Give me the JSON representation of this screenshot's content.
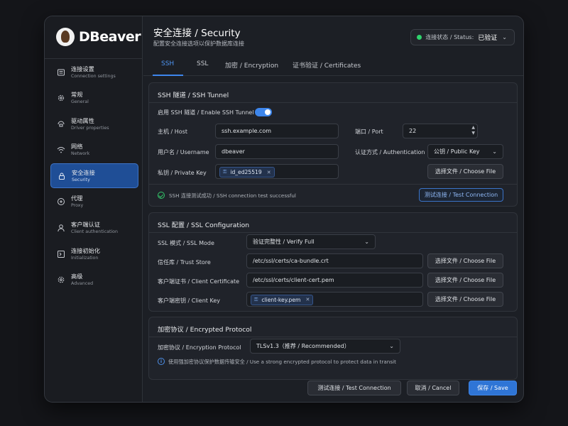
{
  "app": {
    "logo_text": "DBeaver"
  },
  "sidebar": {
    "items": [
      {
        "title": "连接设置",
        "sub": "Connection settings",
        "icon": "connection-icon"
      },
      {
        "title": "常规",
        "sub": "General",
        "icon": "gear-icon"
      },
      {
        "title": "驱动属性",
        "sub": "Driver properties",
        "icon": "driver-icon"
      },
      {
        "title": "网络",
        "sub": "Network",
        "icon": "wifi-icon"
      },
      {
        "title": "安全连接",
        "sub": "Security",
        "icon": "lock-icon",
        "active": true
      },
      {
        "title": "代理",
        "sub": "Proxy",
        "icon": "proxy-icon"
      },
      {
        "title": "客户端认证",
        "sub": "Client authentication",
        "icon": "user-icon"
      },
      {
        "title": "连接初始化",
        "sub": "Initialization",
        "icon": "init-icon"
      },
      {
        "title": "高级",
        "sub": "Advanced",
        "icon": "advanced-gear-icon"
      }
    ]
  },
  "header": {
    "title": "安全连接  /  Security",
    "subtitle": "配置安全连接选项以保护数据库连接",
    "status_label": "连接状态 / Status:",
    "status_value": "已验证",
    "status_color": "#2fd36c"
  },
  "tabs": [
    {
      "label": "SSH",
      "active": true
    },
    {
      "label": "SSL"
    },
    {
      "label": "加密 / Encryption"
    },
    {
      "label": "证书验证 / Certificates"
    }
  ],
  "ssh": {
    "heading": "SSH 隧道  /  SSH Tunnel",
    "enable_label": "启用 SSH 隧道 / Enable SSH Tunnel",
    "enabled": true,
    "host_label": "主机  /  Host",
    "host_value": "ssh.example.com",
    "port_label": "端口  /  Port",
    "port_value": "22",
    "username_label": "用户名  /  Username",
    "username_value": "dbeaver",
    "auth_label": "认证方式  /  Authentication",
    "auth_value": "公钥  /  Public Key",
    "private_key_label": "私钥  /  Private Key",
    "private_key_chip": "id_ed25519",
    "choose_file": "选择文件  /  Choose File",
    "test_result": "SSH 连接测试成功  /  SSH connection test successful",
    "test_button": "测试连接  /  Test Connection"
  },
  "ssl": {
    "heading": "SSL 配置  /  SSL Configuration",
    "mode_label": "SSL 模式  /  SSL Mode",
    "mode_value": "验证完整性  /  Verify Full",
    "truststore_label": "信任库  /  Trust Store",
    "truststore_value": "/etc/ssl/certs/ca-bundle.crt",
    "client_cert_label": "客户端证书  /  Client Certificate",
    "client_cert_value": "/etc/ssl/certs/client-cert.pem",
    "client_key_label": "客户端密钥  /  Client Key",
    "client_key_chip": "client-key.pem",
    "choose_file": "选择文件  /  Choose File"
  },
  "encryption": {
    "heading": "加密协议  /  Encrypted Protocol",
    "protocol_label": "加密协议  /  Encryption Protocol",
    "protocol_value": "TLSv1.3（推荐  /  Recommended）",
    "note": "使用强加密协议保护数据传输安全  /  Use a strong encrypted protocol to protect data in transit"
  },
  "footer": {
    "test_button": "测试连接  /  Test Connection",
    "cancel_button": "取消  /  Cancel",
    "save_button": "保存  /  Save"
  }
}
